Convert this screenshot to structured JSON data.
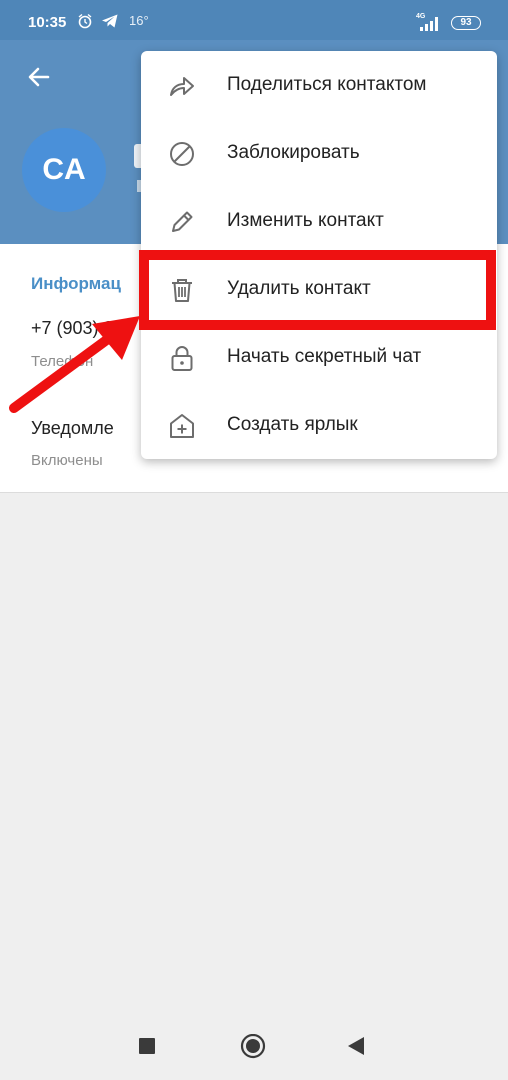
{
  "status_bar": {
    "time": "10:35",
    "temperature": "16°",
    "network": "4G",
    "battery": "93",
    "icons": [
      "alarm-icon",
      "telegram-icon",
      "signal-icon",
      "battery-icon"
    ]
  },
  "header": {
    "avatar_initials": "CA",
    "avatar_color": "#4a90d9",
    "header_color": "#5b8fc0"
  },
  "info": {
    "section_title": "Информац",
    "phone_value": "+7 (903) 3",
    "phone_label": "Телефон",
    "notifications_title": "Уведомле",
    "notifications_value": "Включены"
  },
  "menu": {
    "items": [
      {
        "label": "Поделиться контактом",
        "icon": "share-icon"
      },
      {
        "label": "Заблокировать",
        "icon": "block-icon"
      },
      {
        "label": "Изменить контакт",
        "icon": "pencil-icon"
      },
      {
        "label": "Удалить контакт",
        "icon": "trash-icon"
      },
      {
        "label": "Начать секретный чат",
        "icon": "lock-icon"
      },
      {
        "label": "Создать ярлык",
        "icon": "add-shortcut-icon"
      }
    ]
  },
  "annotation": {
    "highlight_color": "#ee1111",
    "highlighted_item": "Удалить контакт"
  },
  "navbar": {
    "buttons": [
      "recent-apps-icon",
      "home-icon",
      "back-nav-icon"
    ]
  }
}
